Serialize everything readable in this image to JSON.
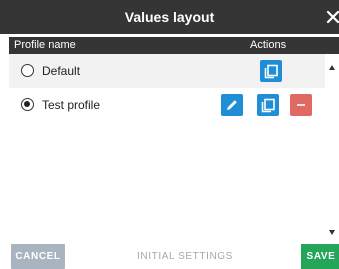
{
  "dialog": {
    "title": "Values layout",
    "close_icon": "close-icon"
  },
  "table": {
    "headers": {
      "name": "Profile name",
      "actions": "Actions"
    },
    "rows": [
      {
        "label": "Default",
        "selected": false,
        "actions": [
          "copy-icon"
        ]
      },
      {
        "label": "Test profile",
        "selected": true,
        "actions": [
          "pencil-icon",
          "copy-icon",
          "minus-icon"
        ]
      }
    ]
  },
  "footer": {
    "cancel_label": "CANCEL",
    "initial_label": "INITIAL SETTINGS",
    "save_label": "SAVE"
  },
  "colors": {
    "header_bg": "#353535",
    "action_blue": "#1e8fd6",
    "action_red": "#e06a63",
    "cancel_bg": "#a8b4c0",
    "save_bg": "#23a55a",
    "selected_row_bg": "#f2f2f2"
  }
}
